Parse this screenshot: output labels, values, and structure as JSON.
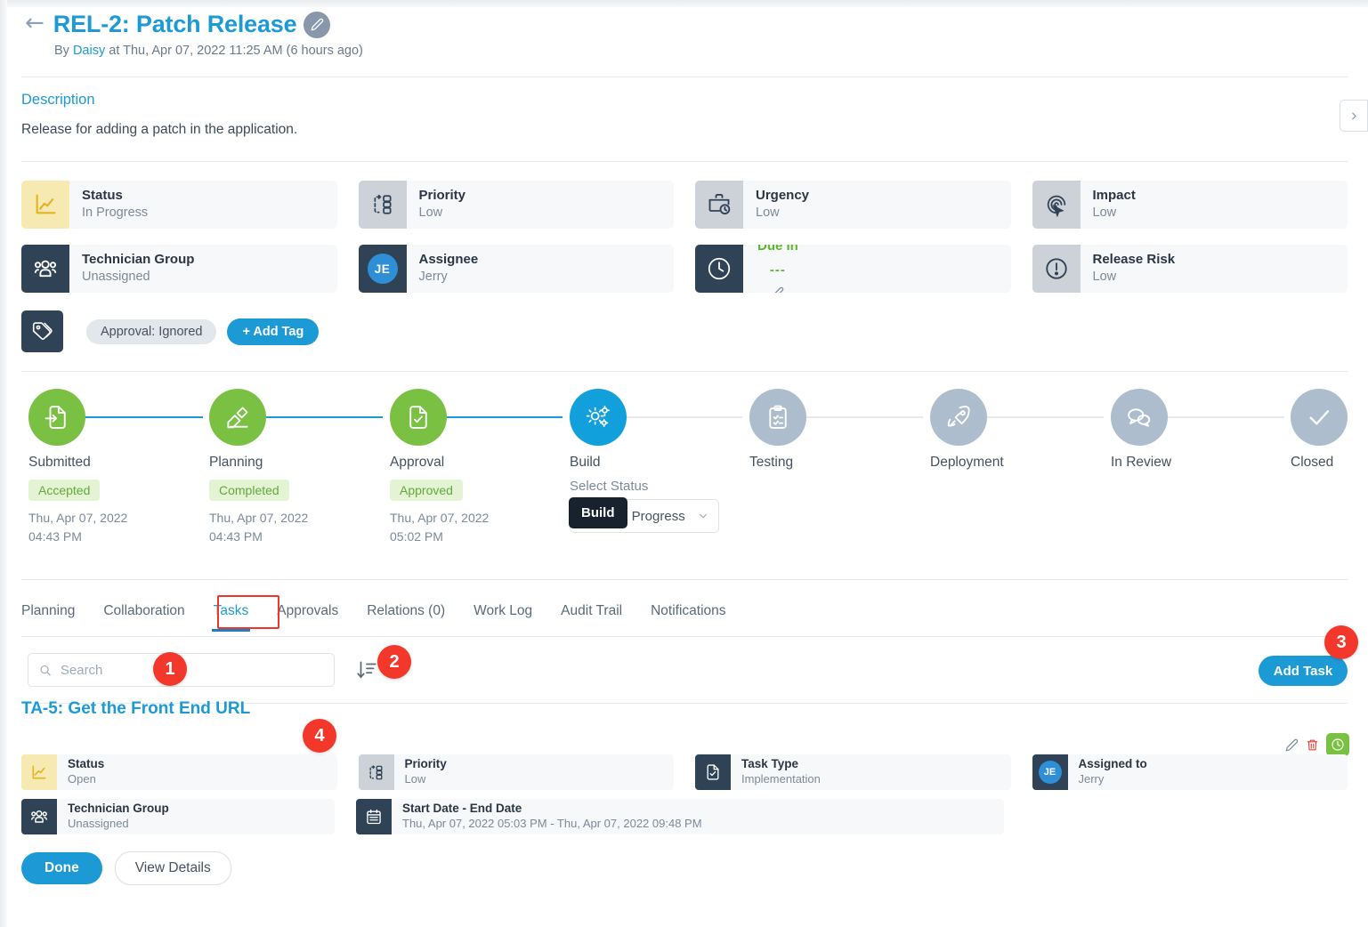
{
  "header": {
    "back_icon": "arrow-left-icon",
    "title": "REL-2: Patch Release",
    "edit_icon": "pencil-icon",
    "byline_prefix": "By",
    "author": "Daisy",
    "byline_suffix": "at Thu, Apr 07, 2022 11:25 AM (6 hours ago)"
  },
  "description": {
    "label": "Description",
    "text": "Release for adding a patch in the application.",
    "expand_icon": "chevron-right-icon"
  },
  "properties": [
    {
      "label": "Status",
      "value": "In Progress",
      "icon": "chart-line-icon",
      "icon_style": "yellow"
    },
    {
      "label": "Priority",
      "value": "Low",
      "icon": "priority-flow-icon",
      "icon_style": "gray"
    },
    {
      "label": "Urgency",
      "value": "Low",
      "icon": "briefcase-clock-icon",
      "icon_style": "gray"
    },
    {
      "label": "Impact",
      "value": "Low",
      "icon": "fingerprint-cursor-icon",
      "icon_style": "gray"
    },
    {
      "label": "Technician Group",
      "value": "Unassigned",
      "icon": "users-group-icon",
      "icon_style": "navy"
    },
    {
      "label": "Assignee",
      "value": "Jerry",
      "icon": "avatar",
      "icon_style": "navy",
      "avatar_initials": "JE"
    },
    {
      "label": "Due In",
      "value": "---",
      "icon": "clock-icon",
      "icon_style": "navy",
      "variant": "due-in",
      "edit_icon": "pencil-icon"
    },
    {
      "label": "Release Risk",
      "value": "Low",
      "icon": "alert-circle-icon",
      "icon_style": "gray"
    }
  ],
  "tags": {
    "icon": "tags-icon",
    "chips": [
      "Approval: Ignored"
    ],
    "add_label": "+ Add Tag"
  },
  "stepper": {
    "select_status_label": "Select Status",
    "selected_status": "In Progress",
    "tooltip": "Build",
    "steps": [
      {
        "name": "Submitted",
        "state": "green",
        "icon": "file-import-icon",
        "badge": "Accepted",
        "date_line1": "Thu, Apr 07, 2022",
        "date_line2": "04:43 PM"
      },
      {
        "name": "Planning",
        "state": "green",
        "icon": "plan-pencil-icon",
        "badge": "Completed",
        "date_line1": "Thu, Apr 07, 2022",
        "date_line2": "04:43 PM"
      },
      {
        "name": "Approval",
        "state": "green",
        "icon": "file-check-icon",
        "badge": "Approved",
        "date_line1": "Thu, Apr 07, 2022",
        "date_line2": "05:02 PM"
      },
      {
        "name": "Build",
        "state": "blue",
        "icon": "gears-icon"
      },
      {
        "name": "Testing",
        "state": "gray",
        "icon": "clipboard-check-icon"
      },
      {
        "name": "Deployment",
        "state": "gray",
        "icon": "rocket-icon"
      },
      {
        "name": "In Review",
        "state": "gray",
        "icon": "chat-bubbles-icon"
      },
      {
        "name": "Closed",
        "state": "gray",
        "icon": "check-icon"
      }
    ]
  },
  "tabs": [
    {
      "label": "Planning",
      "active": false
    },
    {
      "label": "Collaboration",
      "active": false
    },
    {
      "label": "Tasks",
      "active": true
    },
    {
      "label": "Approvals",
      "active": false
    },
    {
      "label": "Relations (0)",
      "active": false
    },
    {
      "label": "Work Log",
      "active": false
    },
    {
      "label": "Audit Trail",
      "active": false
    },
    {
      "label": "Notifications",
      "active": false
    }
  ],
  "toolbar": {
    "search_placeholder": "Search",
    "search_value": "",
    "search_icon": "search-icon",
    "sort_icon": "sort-descending-icon",
    "add_task_label": "Add Task"
  },
  "task": {
    "title": "TA-5: Get the Front End URL",
    "actions": [
      {
        "name": "edit-task",
        "icon": "pencil-icon"
      },
      {
        "name": "delete-task",
        "icon": "trash-icon"
      },
      {
        "name": "task-timer",
        "icon": "clock-icon"
      }
    ],
    "properties": [
      {
        "label": "Status",
        "value": "Open",
        "icon": "chart-line-icon",
        "icon_style": "yellow"
      },
      {
        "label": "Priority",
        "value": "Low",
        "icon": "priority-flow-icon",
        "icon_style": "gray"
      },
      {
        "label": "Task Type",
        "value": "Implementation",
        "icon": "file-check-icon",
        "icon_style": "navy"
      },
      {
        "label": "Assigned to",
        "value": "Jerry",
        "icon": "avatar",
        "icon_style": "navy",
        "avatar_initials": "JE"
      },
      {
        "label": "Technician Group",
        "value": "Unassigned",
        "icon": "users-group-icon",
        "icon_style": "navy"
      },
      {
        "label": "Start Date - End Date",
        "value": "Thu, Apr 07, 2022 05:03 PM - Thu, Apr 07, 2022 09:48 PM",
        "icon": "calendar-icon",
        "icon_style": "navy"
      }
    ],
    "done_label": "Done",
    "view_details_label": "View Details"
  },
  "markers": [
    {
      "number": "1",
      "target": "search-input"
    },
    {
      "number": "2",
      "target": "sort-button"
    },
    {
      "number": "3",
      "target": "add-task-button"
    },
    {
      "number": "4",
      "target": "task-title"
    }
  ],
  "colors": {
    "accent": "#1c9ad6",
    "green": "#7ac143",
    "navy": "#2f4256",
    "marker_red": "#f4372b",
    "highlight_red": "#f0352c",
    "yellow": "#f6e9b2"
  }
}
